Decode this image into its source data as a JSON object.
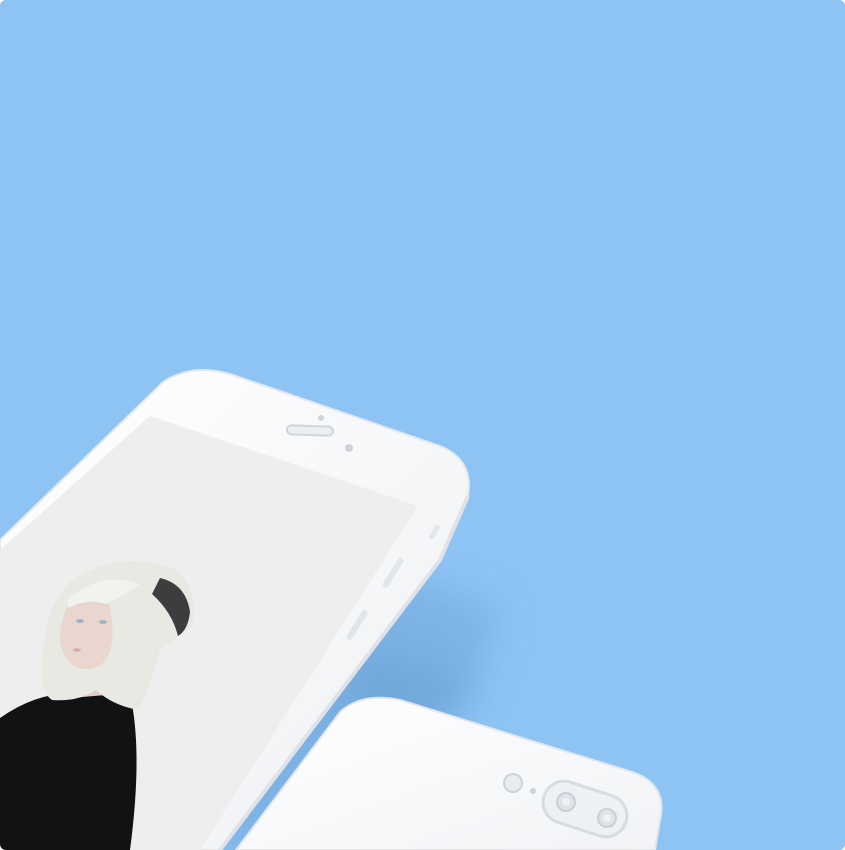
{
  "scene": {
    "background_color": "#8ec4f4",
    "shadow_color": "#6fa6d8",
    "phone_body_color": "#fbfbfc",
    "phone_edge_color": "#e6e9ee",
    "screen_color": "#eeeeee",
    "front_phone": {
      "icons": [
        "earpiece-icon",
        "front-camera-icon",
        "proximity-sensor-icon",
        "volume-up-button",
        "volume-down-button",
        "mute-switch"
      ]
    },
    "back_phone": {
      "icons": [
        "dual-camera-icon",
        "flash-icon",
        "microphone-icon"
      ]
    },
    "photo": {
      "subject": "portrait-of-woman-with-platinum-bob-and-black-top",
      "hair_color": "#e9e9e4",
      "top_color": "#121214",
      "headband_color": "#3c3d3f",
      "skin_color": "#e8d6cf"
    }
  }
}
